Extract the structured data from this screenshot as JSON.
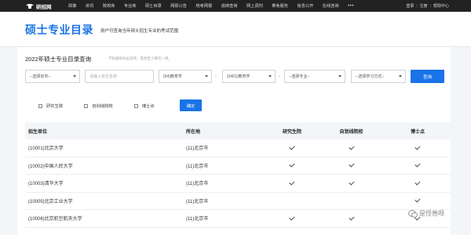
{
  "nav": {
    "logo_text": "研招网",
    "links": [
      "政策",
      "资讯",
      "院校库",
      "专业库",
      "硕士目录",
      "网报公告",
      "统考网报",
      "成绩查询",
      "网上调剂",
      "推免服务",
      "信息公开",
      "在线咨询"
    ],
    "more": "•••",
    "login": "登录",
    "register": "注册",
    "help": "帮助中心",
    "separator": "|"
  },
  "banner": {
    "title": "硕士专业目录",
    "subtitle": "用户可查询当年硕士招生专业的考试范围"
  },
  "query": {
    "title": "2022年硕士专业目录查询",
    "hint": "学科类别为必选项，其他至少填写一项。",
    "province_select": "--选择省市--",
    "unit_placeholder": "请输入单位名称",
    "category_select": "(04)教育学",
    "dash": "-",
    "discipline_select": "(0401)教育学",
    "major_select": "--选择专业--",
    "study_mode_select": "--选择学习方式--",
    "search_button": "查询",
    "filters": [
      "研究生院",
      "自划线院校",
      "博士点"
    ],
    "confirm_button": "确定"
  },
  "table": {
    "headers": [
      "招生单位",
      "所在地",
      "研究生院",
      "自划线院校",
      "博士点"
    ],
    "rows": [
      {
        "unit": "(10001)北京大学",
        "location": "(11)北京市",
        "grad_school": true,
        "self_line": true,
        "doctoral": true
      },
      {
        "unit": "(10002)中国人民大学",
        "location": "(11)北京市",
        "grad_school": true,
        "self_line": true,
        "doctoral": true
      },
      {
        "unit": "(10003)清华大学",
        "location": "(11)北京市",
        "grad_school": true,
        "self_line": true,
        "doctoral": true
      },
      {
        "unit": "(10005)北京工业大学",
        "location": "(11)北京市",
        "grad_school": false,
        "self_line": false,
        "doctoral": true
      },
      {
        "unit": "(10006)北京航空航天大学",
        "location": "(11)北京市",
        "grad_school": true,
        "self_line": true,
        "doctoral": true
      }
    ]
  },
  "watermark": {
    "text": "是怪兽呀"
  }
}
